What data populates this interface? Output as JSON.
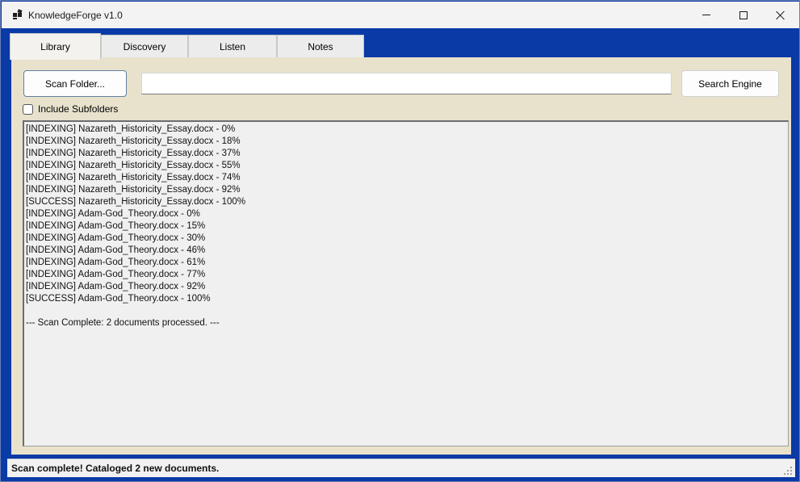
{
  "window": {
    "title": "KnowledgeForge v1.0",
    "icon": "app-icon"
  },
  "tabs": [
    {
      "label": "Library",
      "active": true
    },
    {
      "label": "Discovery",
      "active": false
    },
    {
      "label": "Listen",
      "active": false
    },
    {
      "label": "Notes",
      "active": false
    }
  ],
  "library": {
    "scan_button": "Scan Folder...",
    "path_value": "",
    "search_button": "Search Engine",
    "include_subfolders_label": "Include Subfolders",
    "include_subfolders_checked": false,
    "log_lines": [
      "[INDEXING] Nazareth_Historicity_Essay.docx - 0%",
      "[INDEXING] Nazareth_Historicity_Essay.docx - 18%",
      "[INDEXING] Nazareth_Historicity_Essay.docx - 37%",
      "[INDEXING] Nazareth_Historicity_Essay.docx - 55%",
      "[INDEXING] Nazareth_Historicity_Essay.docx - 74%",
      "[INDEXING] Nazareth_Historicity_Essay.docx - 92%",
      "[SUCCESS] Nazareth_Historicity_Essay.docx - 100%",
      "[INDEXING] Adam-God_Theory.docx - 0%",
      "[INDEXING] Adam-God_Theory.docx - 15%",
      "[INDEXING] Adam-God_Theory.docx - 30%",
      "[INDEXING] Adam-God_Theory.docx - 46%",
      "[INDEXING] Adam-God_Theory.docx - 61%",
      "[INDEXING] Adam-God_Theory.docx - 77%",
      "[INDEXING] Adam-God_Theory.docx - 92%",
      "[SUCCESS] Adam-God_Theory.docx - 100%",
      "",
      "--- Scan Complete: 2 documents processed. ---"
    ]
  },
  "status": {
    "text": "Scan complete! Cataloged 2 new documents."
  },
  "colors": {
    "frame": "#0a3aa6",
    "panel": "#e8e2cd",
    "log_bg": "#f0f0f0"
  }
}
